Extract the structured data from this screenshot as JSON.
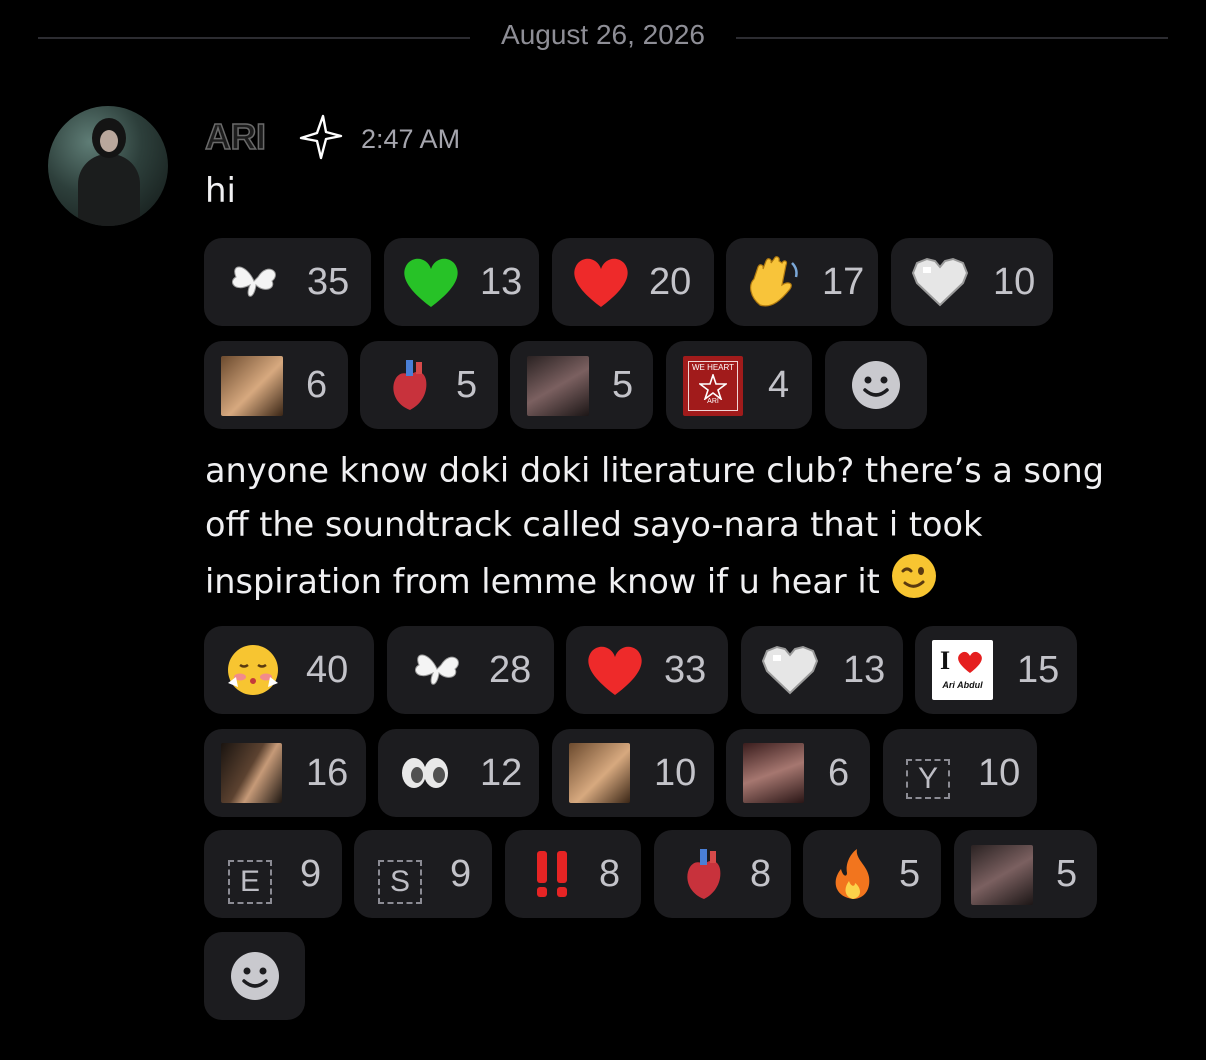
{
  "date_divider": "August 26, 2026",
  "author": {
    "name": "ARI",
    "timestamp": "2:47 AM"
  },
  "messages": [
    {
      "text": "hi",
      "reactions": [
        {
          "emoji": "butterfly-emoji",
          "count": "35"
        },
        {
          "emoji": "green-heart-emoji",
          "count": "13"
        },
        {
          "emoji": "red-heart-emoji",
          "count": "20"
        },
        {
          "emoji": "waving-hand-emoji",
          "count": "17"
        },
        {
          "emoji": "white-pixel-heart-emoji",
          "count": "10"
        },
        {
          "emoji": "face-photo-emoji",
          "count": "6"
        },
        {
          "emoji": "anatomical-heart-emoji",
          "count": "5"
        },
        {
          "emoji": "hand-heart-photo-emoji",
          "count": "5"
        },
        {
          "emoji": "we-heart-ari-badge-emoji",
          "count": "4",
          "badge_text_top": "WE HEART",
          "badge_text_bottom": "ARI"
        }
      ]
    },
    {
      "text_lines": [
        "anyone know doki doki literature club? there’s a song",
        "off the soundtrack called sayo-nara that i took",
        "inspiration from lemme know if u hear it"
      ],
      "reactions": [
        {
          "emoji": "blushing-face-emoji",
          "count": "40"
        },
        {
          "emoji": "butterfly-emoji",
          "count": "28"
        },
        {
          "emoji": "red-heart-emoji",
          "count": "33"
        },
        {
          "emoji": "white-pixel-heart-emoji",
          "count": "13"
        },
        {
          "emoji": "i-love-ari-abdul-emoji",
          "count": "15",
          "badge_text_top": "I",
          "badge_text_bottom": "Ari Abdul"
        },
        {
          "emoji": "selfie-photo-emoji",
          "count": "16"
        },
        {
          "emoji": "blurry-eyes-emoji",
          "count": "12"
        },
        {
          "emoji": "face-photo-emoji",
          "count": "10"
        },
        {
          "emoji": "hands-heart-photo-emoji",
          "count": "6"
        },
        {
          "emoji": "letter-y-emoji",
          "count": "10",
          "letter": "Y"
        },
        {
          "emoji": "letter-e-emoji",
          "count": "9",
          "letter": "E"
        },
        {
          "emoji": "letter-s-emoji",
          "count": "9",
          "letter": "S"
        },
        {
          "emoji": "double-exclamation-emoji",
          "count": "8"
        },
        {
          "emoji": "anatomical-heart-emoji",
          "count": "8"
        },
        {
          "emoji": "fire-emoji",
          "count": "5"
        },
        {
          "emoji": "hand-heart-photo-emoji",
          "count": "5"
        }
      ]
    }
  ],
  "colors": {
    "background": "#000000",
    "chip": "#1c1c1f",
    "count": "#c3c3c9",
    "muted": "#8e8e96"
  }
}
